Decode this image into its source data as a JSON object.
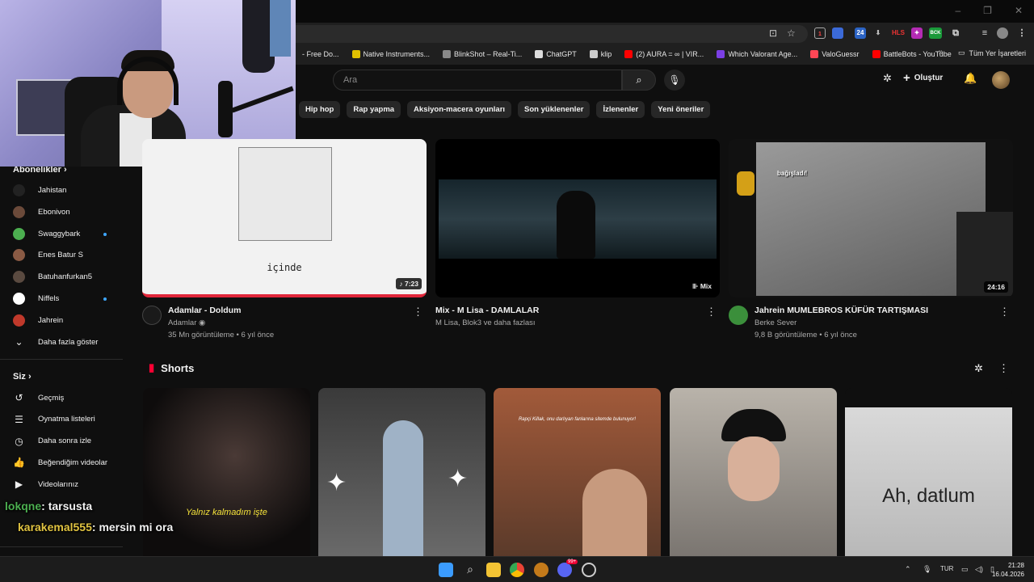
{
  "browser": {
    "window_controls": [
      "–",
      "❐",
      "✕"
    ],
    "bookmarks": [
      {
        "label": "- Free Do...",
        "color": "#1f1f1f"
      },
      {
        "label": "Native Instruments...",
        "color": "#e0c000"
      },
      {
        "label": "BlinkShot – Real-Ti...",
        "color": "#888888"
      },
      {
        "label": "ChatGPT",
        "color": "#dddddd"
      },
      {
        "label": "klip",
        "color": "#cccccc"
      },
      {
        "label": "(2) AURA = ∞ | VIR...",
        "color": "#ff0000"
      },
      {
        "label": "Which Valorant Age...",
        "color": "#7b3fe4"
      },
      {
        "label": "ValoGuessr",
        "color": "#ff4655"
      },
      {
        "label": "BattleBots - YouTube",
        "color": "#ff0000"
      }
    ],
    "bookmarks_more": "»",
    "all_bookmarks": "Tüm Yer İşaretleri",
    "extensions": [
      "1",
      "24",
      "HLS",
      "✦",
      "BCK"
    ]
  },
  "header": {
    "search_placeholder": "Ara",
    "create_label": "Oluştur"
  },
  "chips": [
    "Hip hop",
    "Rap yapma",
    "Aksiyon-macera oyunları",
    "Son yüklenenler",
    "İzlenenler",
    "Yeni öneriler"
  ],
  "sidebar": {
    "subscriptions_title": "Abonelikler",
    "subscriptions": [
      {
        "name": "Jahistan",
        "color": "#222222",
        "dot": false
      },
      {
        "name": "Ebonivon",
        "color": "#6b4a3a",
        "dot": false
      },
      {
        "name": "Swaggybark",
        "color": "#4caf50",
        "dot": true
      },
      {
        "name": "Enes Batur S",
        "color": "#8a5a44",
        "dot": false
      },
      {
        "name": "Batuhanfurkan5",
        "color": "#5a4a40",
        "dot": false
      },
      {
        "name": "Niffels",
        "color": "#ffffff",
        "dot": true
      },
      {
        "name": "Jahrein",
        "color": "#c0392b",
        "dot": false
      }
    ],
    "show_more": "Daha fazla göster",
    "you_title": "Siz",
    "you_items": [
      {
        "label": "Geçmiş",
        "icon": "history-icon",
        "glyph": "↺"
      },
      {
        "label": "Oynatma listeleri",
        "icon": "playlist-icon",
        "glyph": "☰"
      },
      {
        "label": "Daha sonra izle",
        "icon": "clock-icon",
        "glyph": "◷"
      },
      {
        "label": "Beğendiğim videolar",
        "icon": "thumbs-up-icon",
        "glyph": "👍"
      },
      {
        "label": "Videolarınız",
        "icon": "video-icon",
        "glyph": "▶"
      }
    ]
  },
  "videos": [
    {
      "title": "Adamlar - Doldum",
      "channel": "Adamlar",
      "verified": true,
      "stats": "35 Mn görüntüleme • 6 yıl önce",
      "badge": "♪ 7:23",
      "thumb_text": "içinde"
    },
    {
      "title": "Mix - M Lisa - DAMLALAR",
      "channel": "M Lisa, Blok3 ve daha fazlası",
      "verified": false,
      "stats": "",
      "badge": "⊪ Mix",
      "thumb_text": ""
    },
    {
      "title": "Jahrein MUMLEBROS KÜFÜR TARTIŞMASI",
      "channel": "Berke Sever",
      "verified": false,
      "stats": "9,8 B görüntüleme • 6 yıl önce",
      "badge": "24:16",
      "thumb_text": "bağışladı!"
    }
  ],
  "shorts": {
    "title": "Shorts",
    "items": [
      {
        "caption": "Yalnız kalmadım işte"
      },
      {
        "caption": ""
      },
      {
        "caption": "Rapçi Killak, onu darlıyan fanlarına sitemde bulunuyor!"
      },
      {
        "caption": ""
      },
      {
        "caption": "Ah, datlum"
      }
    ]
  },
  "chat": [
    {
      "user": "lokqne",
      "msg": "tarsusta",
      "color": "#4caf50"
    },
    {
      "user": "karakemal555",
      "msg": "mersin mi ora",
      "color": "#e0c341"
    }
  ],
  "taskbar": {
    "lang": "TUR",
    "time": "21:28",
    "date": "16.04.2026",
    "discord_badge": "99+"
  }
}
